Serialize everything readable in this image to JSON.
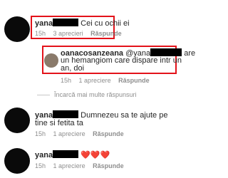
{
  "comments": [
    {
      "username": "yana",
      "text": "Cei cu ochii ei",
      "time": "15h",
      "likes": "3 aprecieri",
      "reply_label": "Răspunde"
    },
    {
      "username": "oanacosanzeana",
      "mention": "@yana",
      "text_line1": "are",
      "text_line2": "un hemangiom care dispare intr un",
      "text_line3": "an, doi",
      "time": "15h",
      "likes": "1 apreciere",
      "reply_label": "Răspunde"
    },
    {
      "username": "yana",
      "text_line1": "Dumnezeu sa te ajute pe",
      "text_line2": "tine si fetita ta",
      "time": "15h",
      "likes": "1 apreciere",
      "reply_label": "Răspunde"
    },
    {
      "username": "yana",
      "text": "❤️❤️❤️",
      "time": "15h",
      "likes": "1 apreciere",
      "reply_label": "Răspunde"
    }
  ],
  "load_more_label": "Încarcă mai multe răspunsuri",
  "colors": {
    "highlight": "#e3121a",
    "meta_text": "#8e8e8e",
    "heart": "#ed1c24"
  }
}
